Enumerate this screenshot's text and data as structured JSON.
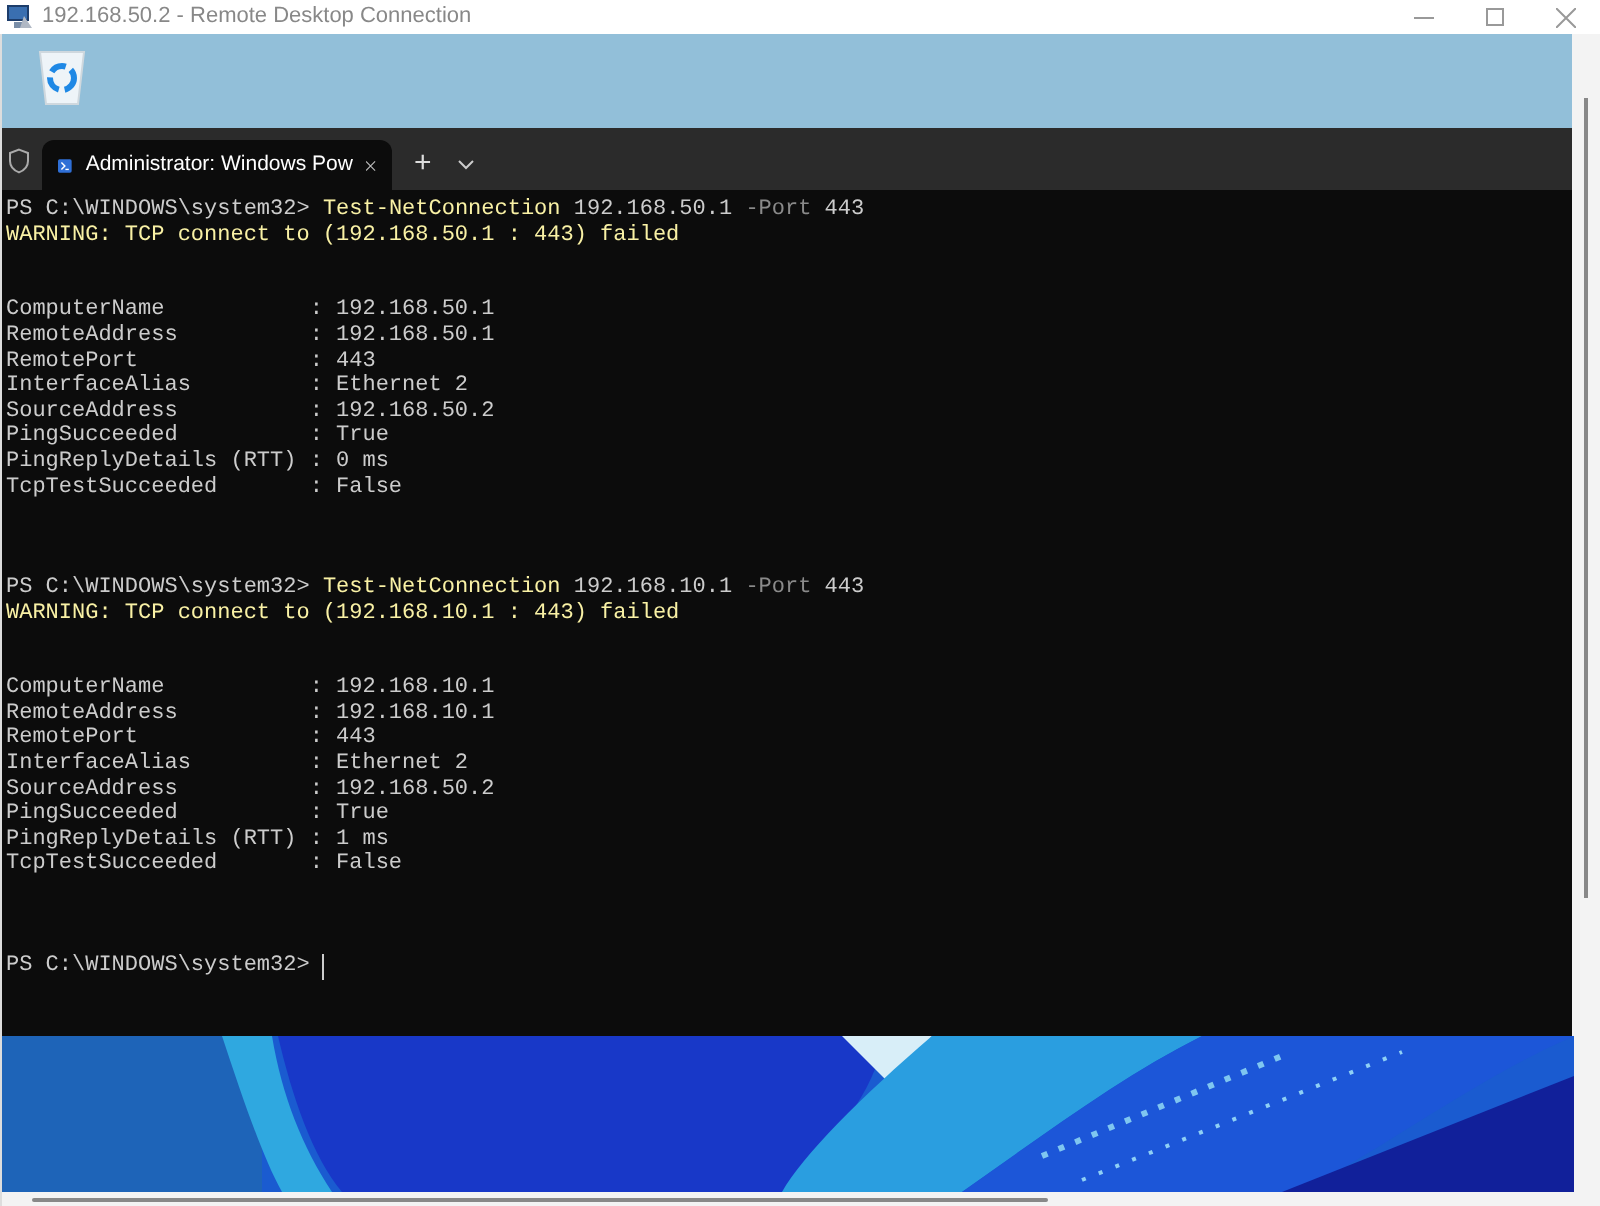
{
  "window": {
    "title": "192.168.50.2 - Remote Desktop Connection"
  },
  "desktop": {
    "icons": [
      {
        "kind": "recycle-bin"
      }
    ]
  },
  "terminal": {
    "tabs": [
      {
        "label": "Administrator: Windows Pow",
        "selected": true
      }
    ],
    "new_tab": "+",
    "lines": [
      {
        "kind": "text",
        "segments": [
          {
            "kind": "prompt",
            "text": "PS C:\\WINDOWS\\system32> "
          },
          {
            "kind": "command",
            "text": "Test-NetConnection"
          },
          {
            "kind": "arg",
            "text": " 192.168.50.1 "
          },
          {
            "kind": "param",
            "text": "-Port"
          },
          {
            "kind": "arg",
            "text": " 443"
          }
        ]
      },
      {
        "kind": "text",
        "segments": [
          {
            "kind": "warning",
            "text": "WARNING: TCP connect to (192.168.50.1 : 443) failed"
          }
        ]
      },
      {
        "kind": "blank"
      },
      {
        "kind": "blank"
      },
      {
        "kind": "text",
        "segments": [
          {
            "kind": "output",
            "text": "ComputerName           : 192.168.50.1"
          }
        ]
      },
      {
        "kind": "text",
        "segments": [
          {
            "kind": "output",
            "text": "RemoteAddress          : 192.168.50.1"
          }
        ]
      },
      {
        "kind": "text",
        "segments": [
          {
            "kind": "output",
            "text": "RemotePort             : 443"
          }
        ]
      },
      {
        "kind": "text",
        "segments": [
          {
            "kind": "output",
            "text": "InterfaceAlias         : Ethernet 2"
          }
        ]
      },
      {
        "kind": "text",
        "segments": [
          {
            "kind": "output",
            "text": "SourceAddress          : 192.168.50.2"
          }
        ]
      },
      {
        "kind": "text",
        "segments": [
          {
            "kind": "output",
            "text": "PingSucceeded          : True"
          }
        ]
      },
      {
        "kind": "text",
        "segments": [
          {
            "kind": "output",
            "text": "PingReplyDetails (RTT) : 0 ms"
          }
        ]
      },
      {
        "kind": "text",
        "segments": [
          {
            "kind": "output",
            "text": "TcpTestSucceeded       : False"
          }
        ]
      },
      {
        "kind": "blank"
      },
      {
        "kind": "blank"
      },
      {
        "kind": "blank"
      },
      {
        "kind": "text",
        "segments": [
          {
            "kind": "prompt",
            "text": "PS C:\\WINDOWS\\system32> "
          },
          {
            "kind": "command",
            "text": "Test-NetConnection"
          },
          {
            "kind": "arg",
            "text": " 192.168.10.1 "
          },
          {
            "kind": "param",
            "text": "-Port"
          },
          {
            "kind": "arg",
            "text": " 443"
          }
        ]
      },
      {
        "kind": "text",
        "segments": [
          {
            "kind": "warning",
            "text": "WARNING: TCP connect to (192.168.10.1 : 443) failed"
          }
        ]
      },
      {
        "kind": "blank"
      },
      {
        "kind": "blank"
      },
      {
        "kind": "text",
        "segments": [
          {
            "kind": "output",
            "text": "ComputerName           : 192.168.10.1"
          }
        ]
      },
      {
        "kind": "text",
        "segments": [
          {
            "kind": "output",
            "text": "RemoteAddress          : 192.168.10.1"
          }
        ]
      },
      {
        "kind": "text",
        "segments": [
          {
            "kind": "output",
            "text": "RemotePort             : 443"
          }
        ]
      },
      {
        "kind": "text",
        "segments": [
          {
            "kind": "output",
            "text": "InterfaceAlias         : Ethernet 2"
          }
        ]
      },
      {
        "kind": "text",
        "segments": [
          {
            "kind": "output",
            "text": "SourceAddress          : 192.168.50.2"
          }
        ]
      },
      {
        "kind": "text",
        "segments": [
          {
            "kind": "output",
            "text": "PingSucceeded          : True"
          }
        ]
      },
      {
        "kind": "text",
        "segments": [
          {
            "kind": "output",
            "text": "PingReplyDetails (RTT) : 1 ms"
          }
        ]
      },
      {
        "kind": "text",
        "segments": [
          {
            "kind": "output",
            "text": "TcpTestSucceeded       : False"
          }
        ]
      },
      {
        "kind": "blank"
      },
      {
        "kind": "blank"
      },
      {
        "kind": "blank"
      },
      {
        "kind": "text",
        "cursor": true,
        "segments": [
          {
            "kind": "prompt",
            "text": "PS C:\\WINDOWS\\system32> "
          }
        ]
      }
    ]
  }
}
